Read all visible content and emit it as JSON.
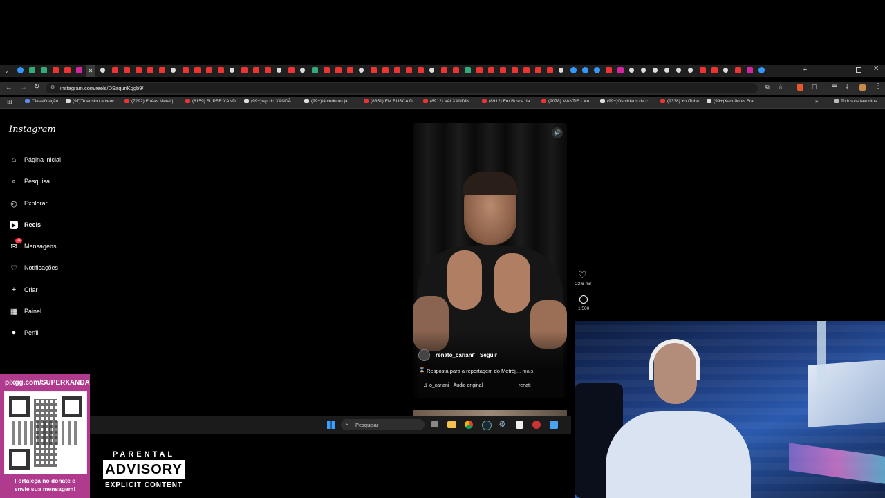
{
  "browser": {
    "url": "instagram.com/reels/DSaqunKggb9/",
    "bookmarks": [
      "Classificação",
      "(97)Te ensino a venc...",
      "(7292) Enéas Metal |...",
      "(8159) SUPER XAND...",
      "(99+)rap do XANDÃ...",
      "(99+)tá cedo ou já...",
      "(8851) EM BUSCA D...",
      "(8912) VAI XANDIN...",
      "(8912) Em Busca da...",
      "(9078) MANTIS · XA...",
      "(99+)Os vídeos de c...",
      "(9338) YouTube",
      "(99+)Xandão vs Fra..."
    ],
    "all_bookmarks": "Todos os favoritos"
  },
  "instagram": {
    "logo": "Instagram",
    "nav": [
      {
        "label": "Página inicial",
        "icon": "home-icon"
      },
      {
        "label": "Pesquisa",
        "icon": "search-icon"
      },
      {
        "label": "Explorar",
        "icon": "compass-icon"
      },
      {
        "label": "Reels",
        "icon": "reels-icon"
      },
      {
        "label": "Mensagens",
        "icon": "messenger-icon",
        "badge": "9+"
      },
      {
        "label": "Notificações",
        "icon": "heart-icon"
      },
      {
        "label": "Criar",
        "icon": "plus-icon"
      },
      {
        "label": "Painel",
        "icon": "chart-icon"
      },
      {
        "label": "Perfil",
        "icon": "avatar-icon"
      }
    ],
    "reel": {
      "username": "renato_cariani",
      "follow": "Seguir",
      "caption": "Resposta para a reportagem do Metrój",
      "more": "... mais",
      "audio": "o_cariani · Áudio original",
      "audio_user": "renati",
      "likes": "22,6 mil",
      "comments": "1.500"
    }
  },
  "taskbar": {
    "search_placeholder": "Pesquisar"
  },
  "overlay": {
    "url": "pixgg.com/SUPERXANDA",
    "donate_line1": "Fortaleça no donate e",
    "donate_line2": "envie sua mensagem!",
    "advisory_top": "PARENTAL",
    "advisory_main": "ADVISORY",
    "advisory_bottom": "EXPLICIT CONTENT"
  },
  "colors": {
    "background": "#000000",
    "chrome": "#2b2b2b",
    "accent_red": "#ff3040",
    "overlay_pink": "#b03a8e"
  }
}
